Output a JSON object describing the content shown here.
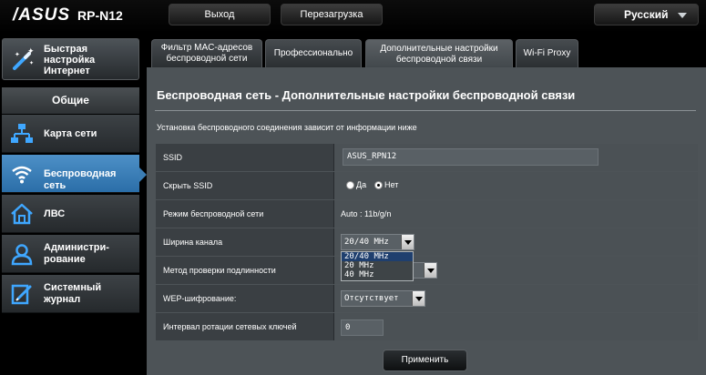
{
  "header": {
    "brand": "/ASUS",
    "model": "RP-N12",
    "logout_label": "Выход",
    "reboot_label": "Перезагрузка",
    "language": "Русский"
  },
  "sidebar": {
    "quick_setup": [
      "Быстрая",
      "настройка",
      "Интернет"
    ],
    "general_title": "Общие",
    "items": [
      {
        "label_lines": [
          "Карта сети"
        ],
        "icon": "network-map-icon",
        "active": false
      },
      {
        "label_lines": [
          "Беспроводная сеть"
        ],
        "icon": "wifi-icon",
        "active": true
      },
      {
        "label_lines": [
          "ЛВС"
        ],
        "icon": "home-lan-icon",
        "active": false
      },
      {
        "label_lines": [
          "Администри-",
          "рование"
        ],
        "icon": "admin-user-icon",
        "active": false
      },
      {
        "label_lines": [
          "Системный",
          "журнал"
        ],
        "icon": "system-log-icon",
        "active": false
      }
    ]
  },
  "tabs": [
    {
      "lines": [
        "Фильтр MAC-адресов",
        "беспроводной сети"
      ],
      "active": false
    },
    {
      "lines": [
        "Профессионально"
      ],
      "active": false
    },
    {
      "lines": [
        "Дополнительные настройки",
        "беспроводной связи"
      ],
      "active": true
    },
    {
      "lines": [
        "Wi-Fi Proxy"
      ],
      "active": false
    }
  ],
  "main": {
    "title": "Беспроводная сеть - Дополнительные настройки беспроводной связи",
    "description": "Установка беспроводного соединения зависит от информации ниже",
    "fields": {
      "ssid": {
        "label": "SSID",
        "value": "ASUS_RPN12"
      },
      "hide_ssid": {
        "label": "Скрыть SSID",
        "yes": "Да",
        "no": "Нет",
        "selected": "no"
      },
      "mode": {
        "label": "Режим беспроводной сети",
        "value": "Auto : 11b/g/n"
      },
      "bandwidth": {
        "label": "Ширина канала",
        "value": "20/40 MHz",
        "options": [
          "20/40 MHz",
          "20 MHz",
          "40 MHz"
        ]
      },
      "auth": {
        "label": "Метод проверки подлинности"
      },
      "wep": {
        "label": "WEP-шифрование:",
        "value": "Отсутствует"
      },
      "rekey": {
        "label": "Интервал ротации сетевых ключей",
        "value": "0"
      }
    },
    "apply_label": "Применить"
  },
  "colors": {
    "accent": "#3b7db4",
    "panel": "#4d5357",
    "label_cell": "#3a3f43"
  }
}
